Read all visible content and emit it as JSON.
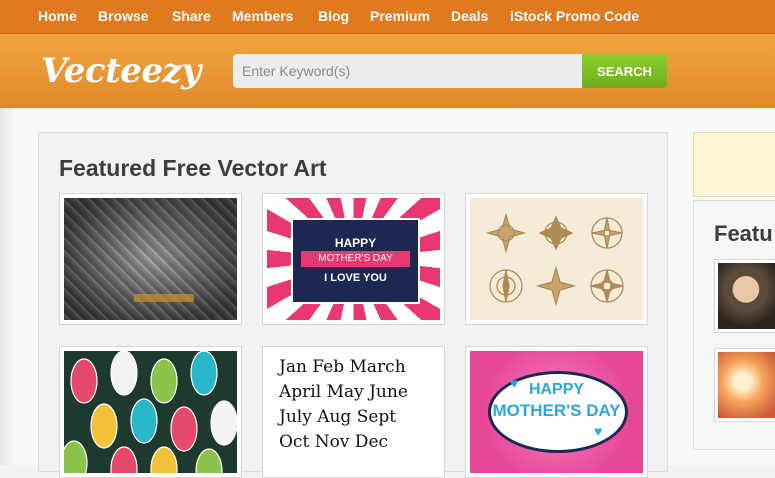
{
  "nav": {
    "items": [
      {
        "label": "Home"
      },
      {
        "label": "Browse"
      },
      {
        "label": "Share"
      },
      {
        "label": "Members"
      },
      {
        "label": "Blog"
      },
      {
        "label": "Premium"
      },
      {
        "label": "Deals"
      },
      {
        "label": "iStock Promo Code"
      }
    ]
  },
  "header": {
    "logo": "Vecteezy",
    "search_placeholder": "Enter Keyword(s)",
    "search_button": "SEARCH"
  },
  "featured": {
    "title": "Featured Free Vector Art",
    "thumbs": [
      {
        "label": "metal-plate"
      },
      {
        "label": "happy-mothers-day-retro",
        "texts": [
          "HAPPY",
          "MOTHER'S DAY",
          "I LOVE YOU"
        ]
      },
      {
        "label": "compass-roses"
      },
      {
        "label": "leaf-pattern"
      },
      {
        "label": "hand-lettered-months",
        "texts": [
          "Jan Feb March",
          "April May June",
          "July Aug Sept",
          "Oct Nov Dec"
        ]
      },
      {
        "label": "mothers-day-comic",
        "texts": [
          "HAPPY",
          "MOTHER'S DAY"
        ]
      }
    ]
  },
  "sidebar": {
    "title": "Featu"
  },
  "colors": {
    "nav_bg": "#e07a1e",
    "header_bg": "#e8962f",
    "search_btn": "#7bbf24",
    "promo_bg": "#fdf6d6"
  }
}
